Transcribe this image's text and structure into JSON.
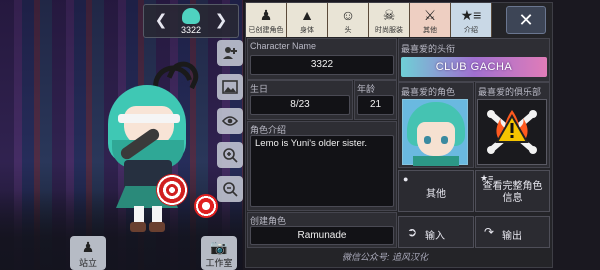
{
  "character": {
    "id": "3322"
  },
  "left_buttons": {
    "stand_label": "站立",
    "studio_label": "工作室"
  },
  "tabs": [
    {
      "label": "已创建角色",
      "icon": "person-icon"
    },
    {
      "label": "身体",
      "icon": "body-icon"
    },
    {
      "label": "头",
      "icon": "head-icon"
    },
    {
      "label": "时尚服装",
      "icon": "shirt-icon"
    },
    {
      "label": "其他",
      "icon": "sword-cat-icon"
    },
    {
      "label": "介绍",
      "icon": "star-list-icon"
    }
  ],
  "profile": {
    "name_label": "Character Name",
    "name_value": "3322",
    "birthday_label": "生日",
    "birthday_value": "8/23",
    "age_label": "年龄",
    "age_value": "21",
    "intro_label": "角色介绍",
    "intro_value": "Lemo is Yuni's older sister.",
    "creator_label": "创建角色",
    "creator_value": "Ramunade",
    "fav_title_label": "最喜爱的头衔",
    "fav_title_value": "CLUB GACHA",
    "fav_char_label": "最喜爱的角色",
    "fav_club_label": "最喜爱的俱乐部"
  },
  "actions": {
    "other_label": "其他",
    "view_full_label": "查看完整角色信息",
    "import_label": "输入",
    "export_label": "输出"
  },
  "footer": {
    "watermark": "微信公众号: 追风汉化"
  },
  "colors": {
    "panel_bg": "#242428",
    "tab_bg": "#e9e4d6",
    "title_gradient_start": "#6fd0d6",
    "title_gradient_end": "#e07cb8",
    "hair": "#3fc8b4"
  }
}
